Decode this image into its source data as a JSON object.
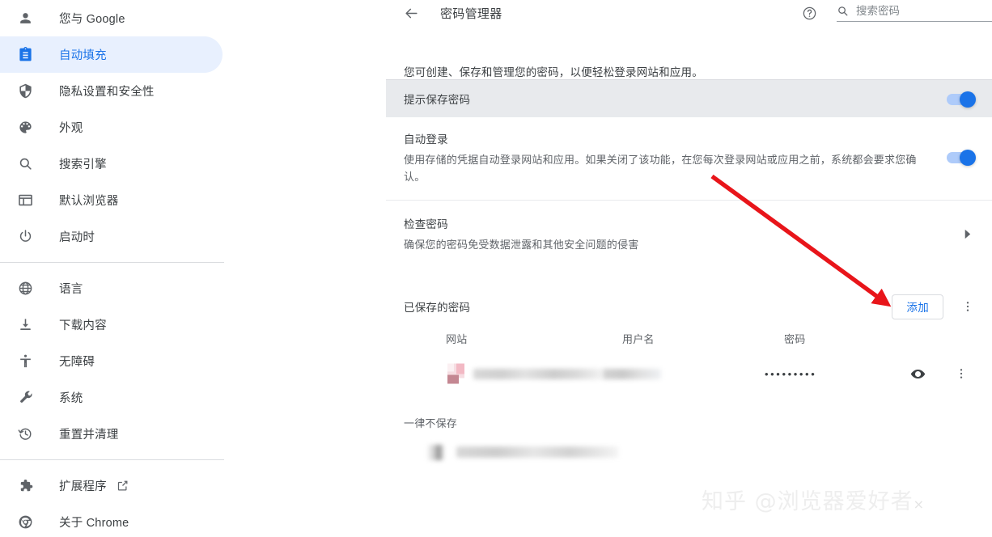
{
  "sidebar": {
    "groups": [
      {
        "items": [
          {
            "label": "您与 Google",
            "icon": "person-icon",
            "selected": false
          },
          {
            "label": "自动填充",
            "icon": "autofill-clipboard-icon",
            "selected": true
          },
          {
            "label": "隐私设置和安全性",
            "icon": "shield-icon",
            "selected": false
          },
          {
            "label": "外观",
            "icon": "palette-icon",
            "selected": false
          },
          {
            "label": "搜索引擎",
            "icon": "search-icon",
            "selected": false
          },
          {
            "label": "默认浏览器",
            "icon": "browser-window-icon",
            "selected": false
          },
          {
            "label": "启动时",
            "icon": "power-icon",
            "selected": false
          }
        ]
      },
      {
        "items": [
          {
            "label": "语言",
            "icon": "globe-icon",
            "selected": false
          },
          {
            "label": "下载内容",
            "icon": "download-icon",
            "selected": false
          },
          {
            "label": "无障碍",
            "icon": "accessibility-icon",
            "selected": false
          },
          {
            "label": "系统",
            "icon": "wrench-icon",
            "selected": false
          },
          {
            "label": "重置并清理",
            "icon": "restore-clock-icon",
            "selected": false
          }
        ]
      },
      {
        "items": [
          {
            "label": "扩展程序",
            "icon": "puzzle-icon",
            "selected": false,
            "external": true
          },
          {
            "label": "关于 Chrome",
            "icon": "chrome-logo-icon",
            "selected": false
          }
        ]
      }
    ]
  },
  "header": {
    "title": "密码管理器",
    "back_icon": "back-arrow-icon",
    "help_icon": "help-circle-icon",
    "search": {
      "icon": "search-icon",
      "placeholder": "搜索密码",
      "value": ""
    }
  },
  "main": {
    "intro": "您可创建、保存和管理您的密码，以便轻松登录网站和应用。",
    "prompt_save": {
      "label": "提示保存密码",
      "toggle_on": true
    },
    "auto_signin": {
      "title": "自动登录",
      "description": "使用存储的凭据自动登录网站和应用。如果关闭了该功能，在您每次登录网站或应用之前，系统都会要求您确认。",
      "toggle_on": true
    },
    "check_passwords": {
      "title": "检查密码",
      "description": "确保您的密码免受数据泄露和其他安全问题的侵害",
      "chevron_icon": "chevron-right-icon"
    },
    "saved_passwords": {
      "section_label": "已保存的密码",
      "add_button": "添加",
      "overflow_icon": "kebab-menu-icon",
      "columns": [
        "网站",
        "用户名",
        "密码"
      ],
      "rows": [
        {
          "site": "",
          "username": "",
          "password_mask": "•••••••••",
          "show_icon": "eye-icon",
          "overflow_icon": "kebab-menu-icon"
        }
      ]
    },
    "never_saved": {
      "section_label": "一律不保存",
      "rows": [
        {
          "site": ""
        }
      ]
    }
  },
  "watermark": {
    "text": "知乎 @浏览器爱好者",
    "suffix": "×"
  },
  "annotation": {
    "type": "arrow",
    "color": "#e8151a",
    "points": "from (880,218) to (1098,377)"
  },
  "colors": {
    "accent": "#1a73e8",
    "selected_bg": "#e8f0fe",
    "row_highlight": "#e8eaed",
    "text_primary": "#3c4043",
    "text_secondary": "#5f6368",
    "annotation_red": "#e8151a"
  }
}
